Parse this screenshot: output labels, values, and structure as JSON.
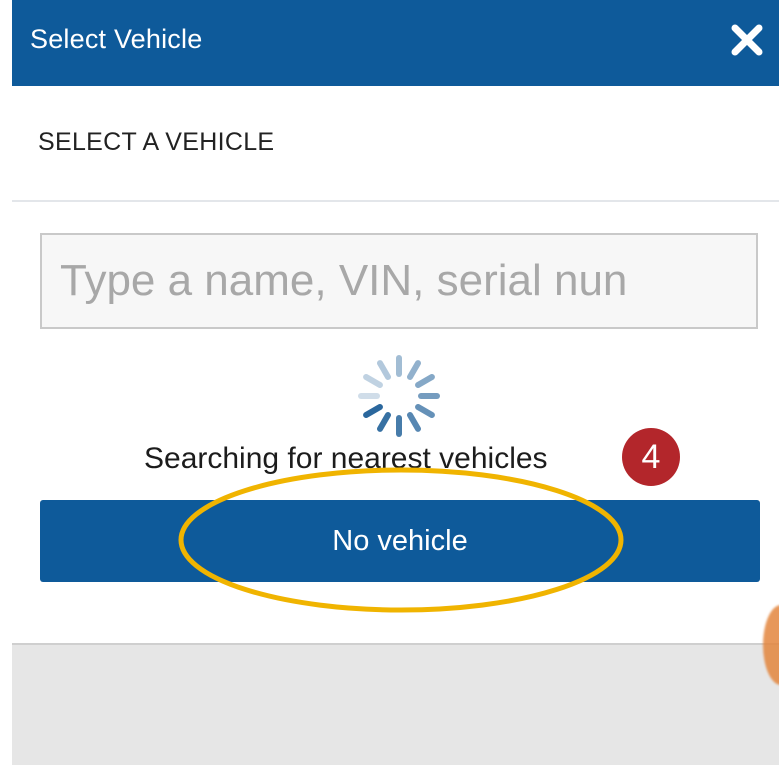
{
  "dialog": {
    "title": "Select Vehicle",
    "close_icon": "close-x-icon",
    "subtitle": "SELECT A VEHICLE"
  },
  "search": {
    "placeholder": "Type a name, VIN, serial nun",
    "value": ""
  },
  "loading": {
    "icon": "spinner-icon",
    "status_text": "Searching for nearest vehicles"
  },
  "actions": {
    "no_vehicle_label": "No vehicle"
  },
  "annotation": {
    "step_number": "4",
    "highlight_target": "no-vehicle-button"
  },
  "colors": {
    "header_bg": "#0e5a9a",
    "button_bg": "#0e5a9a",
    "badge_bg": "#b3262b",
    "highlight_stroke": "#f0b400",
    "spinner": "#1a5c96"
  }
}
